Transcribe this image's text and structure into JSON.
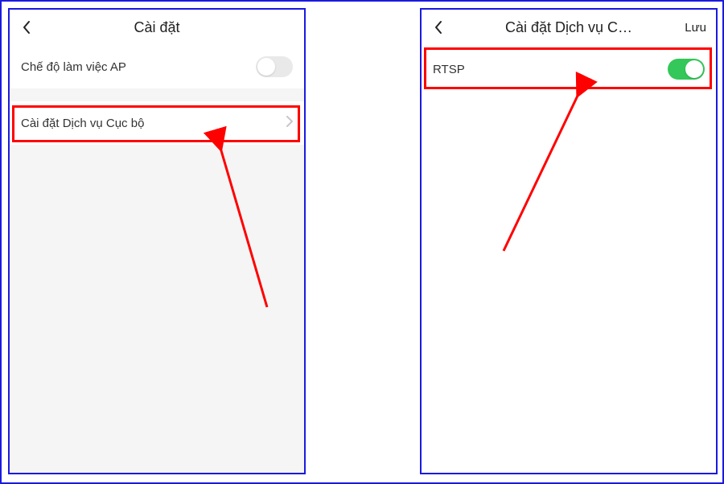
{
  "left_screen": {
    "header": {
      "title": "Cài đặt"
    },
    "rows": {
      "ap_mode": {
        "label": "Chế độ làm việc AP",
        "toggle": "off"
      },
      "local_service": {
        "label": "Cài đặt Dịch vụ Cục bộ"
      }
    }
  },
  "right_screen": {
    "header": {
      "title": "Cài đặt Dịch vụ C…",
      "action": "Lưu"
    },
    "rows": {
      "rtsp": {
        "label": "RTSP",
        "toggle": "on"
      }
    }
  },
  "annotations": {
    "highlight_color": "#ff0000",
    "frame_color": "#1a1ae0"
  }
}
